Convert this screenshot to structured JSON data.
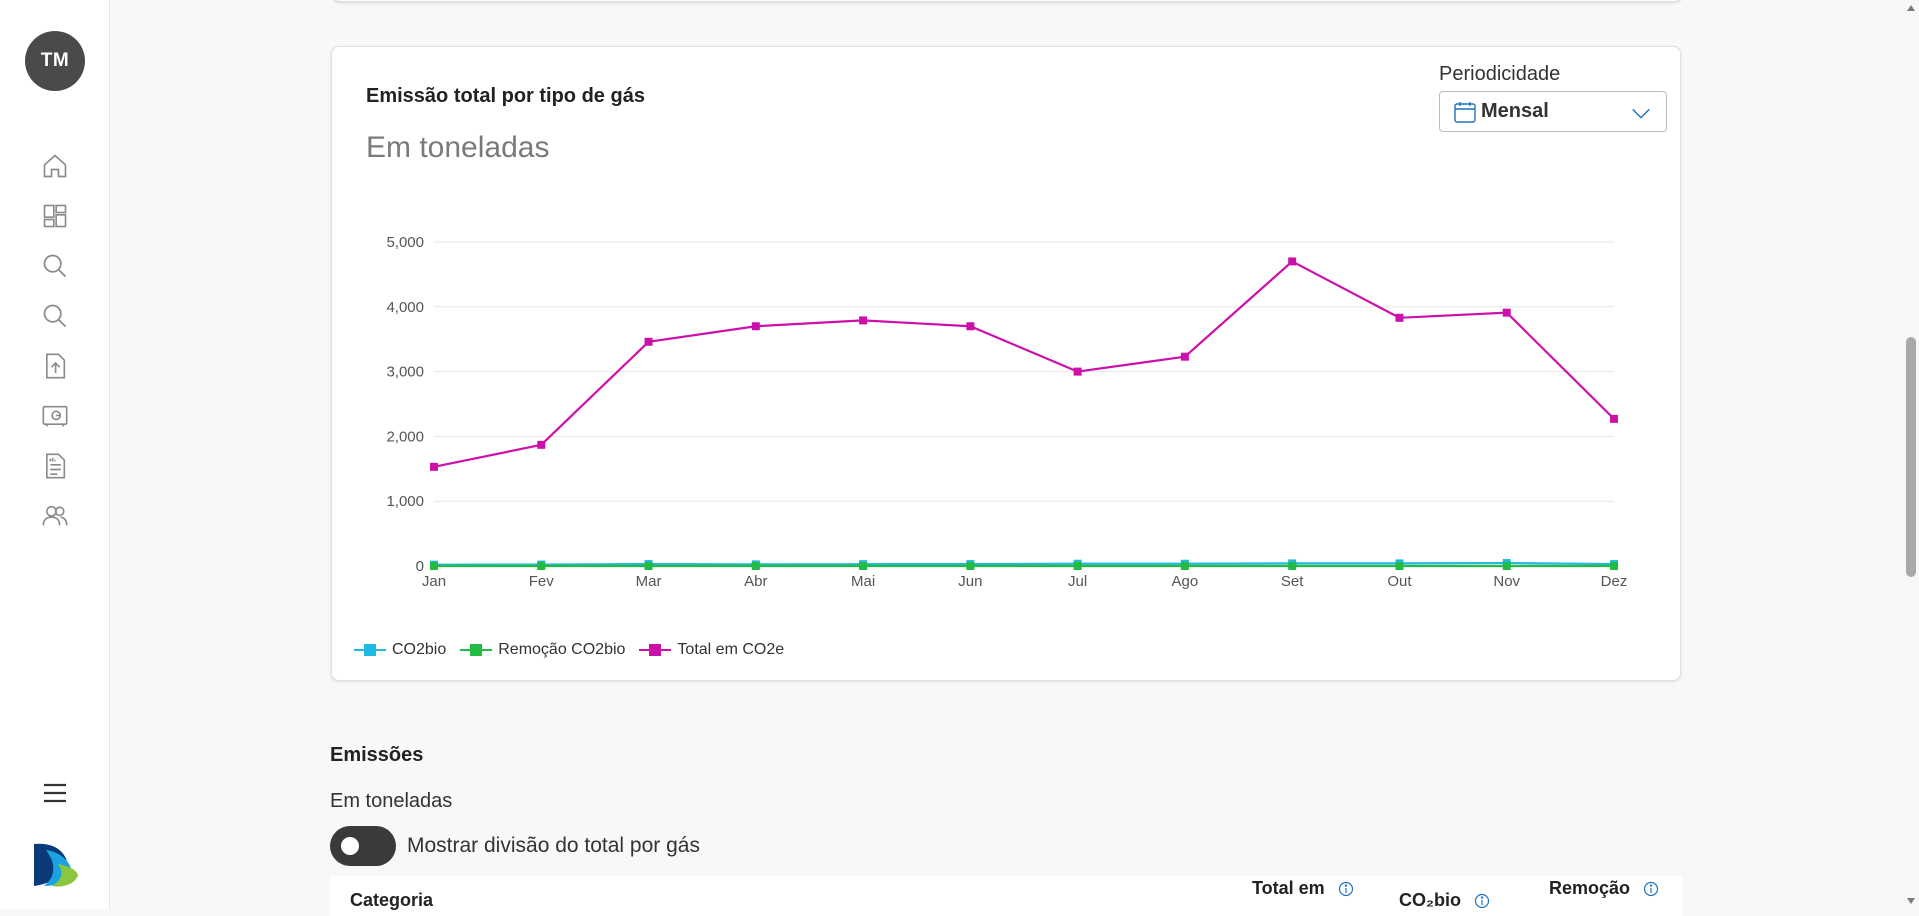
{
  "user": {
    "initials": "TM"
  },
  "nav": {
    "items": [
      {
        "name": "home-icon"
      },
      {
        "name": "dashboard-icon"
      },
      {
        "name": "search-icon"
      },
      {
        "name": "search-icon-2"
      },
      {
        "name": "upload-file-icon"
      },
      {
        "name": "vault-icon"
      },
      {
        "name": "report-icon"
      },
      {
        "name": "users-icon"
      }
    ]
  },
  "chart_card": {
    "title": "Emissão total por tipo de gás",
    "subtitle": "Em toneladas",
    "period_label": "Periodicidade",
    "period_value": "Mensal"
  },
  "chart_data": {
    "type": "line",
    "title": "Emissão total por tipo de gás",
    "subtitle": "Em toneladas",
    "xlabel": "",
    "ylabel": "",
    "categories": [
      "Jan",
      "Fev",
      "Mar",
      "Abr",
      "Mai",
      "Jun",
      "Jul",
      "Ago",
      "Set",
      "Out",
      "Nov",
      "Dez"
    ],
    "y_ticks": [
      "0",
      "1,000",
      "2,000",
      "3,000",
      "4,000",
      "5,000"
    ],
    "ylim": [
      0,
      5000
    ],
    "grid": true,
    "legend_position": "bottom-left",
    "series": [
      {
        "name": "CO2bio",
        "color": "#1fb8e0",
        "values": [
          20,
          22,
          30,
          25,
          28,
          30,
          35,
          35,
          40,
          40,
          45,
          30
        ]
      },
      {
        "name": "Remoção CO2bio",
        "color": "#22bb44",
        "values": [
          0,
          0,
          0,
          0,
          0,
          0,
          0,
          0,
          0,
          0,
          0,
          0
        ]
      },
      {
        "name": "Total em CO2e",
        "color": "#cc11aa",
        "values": [
          1530,
          1870,
          3460,
          3700,
          3790,
          3700,
          3000,
          3230,
          4700,
          3830,
          3910,
          2270
        ]
      }
    ]
  },
  "emissions": {
    "title": "Emissões",
    "subtitle": "Em toneladas",
    "toggle_label": "Mostrar divisão do total por gás"
  },
  "table": {
    "headers": [
      "Categoria",
      "Total em",
      "CO₂bio",
      "Remoção"
    ]
  },
  "colors": {
    "accent": "#1e73be",
    "avatar": "#4a4a4a",
    "toggle": "#3a3a3a"
  }
}
